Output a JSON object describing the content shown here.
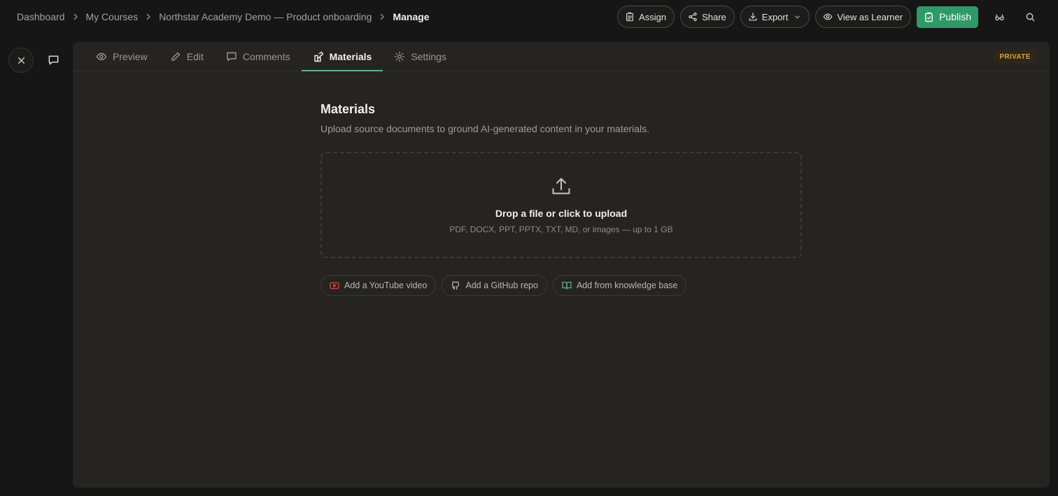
{
  "breadcrumb": {
    "items": [
      "Dashboard",
      "My Courses",
      "Northstar Academy Demo — Product onboarding"
    ],
    "current": "Manage"
  },
  "toolbar": {
    "assign": "Assign",
    "share": "Share",
    "export": "Export",
    "view_as_learner": "View as Learner",
    "publish": "Publish"
  },
  "tabs": [
    {
      "label": "Preview",
      "icon": "eye-icon"
    },
    {
      "label": "Edit",
      "icon": "pencil-icon"
    },
    {
      "label": "Comments",
      "icon": "comment-icon"
    },
    {
      "label": "Materials",
      "icon": "materials-icon",
      "active": true
    },
    {
      "label": "Settings",
      "icon": "gear-icon"
    }
  ],
  "badge": "PRIVATE",
  "materials": {
    "title": "Materials",
    "subtitle": "Upload source documents to ground AI-generated content in your materials.",
    "dropzone": {
      "title": "Drop a file or click to upload",
      "hint": "PDF, DOCX, PPT, PPTX, TXT, MD, or images — up to 1 GB"
    },
    "sources": [
      {
        "label": "Add a YouTube video",
        "icon": "youtube-icon"
      },
      {
        "label": "Add a GitHub repo",
        "icon": "github-icon"
      },
      {
        "label": "Add from knowledge base",
        "icon": "book-icon"
      }
    ]
  },
  "colors": {
    "publish": "#2f9a68",
    "active_tab_underline": "#6fae86",
    "badge_text": "#e0a03d",
    "youtube": "#e0413a",
    "knowledge": "#5bb07c"
  }
}
